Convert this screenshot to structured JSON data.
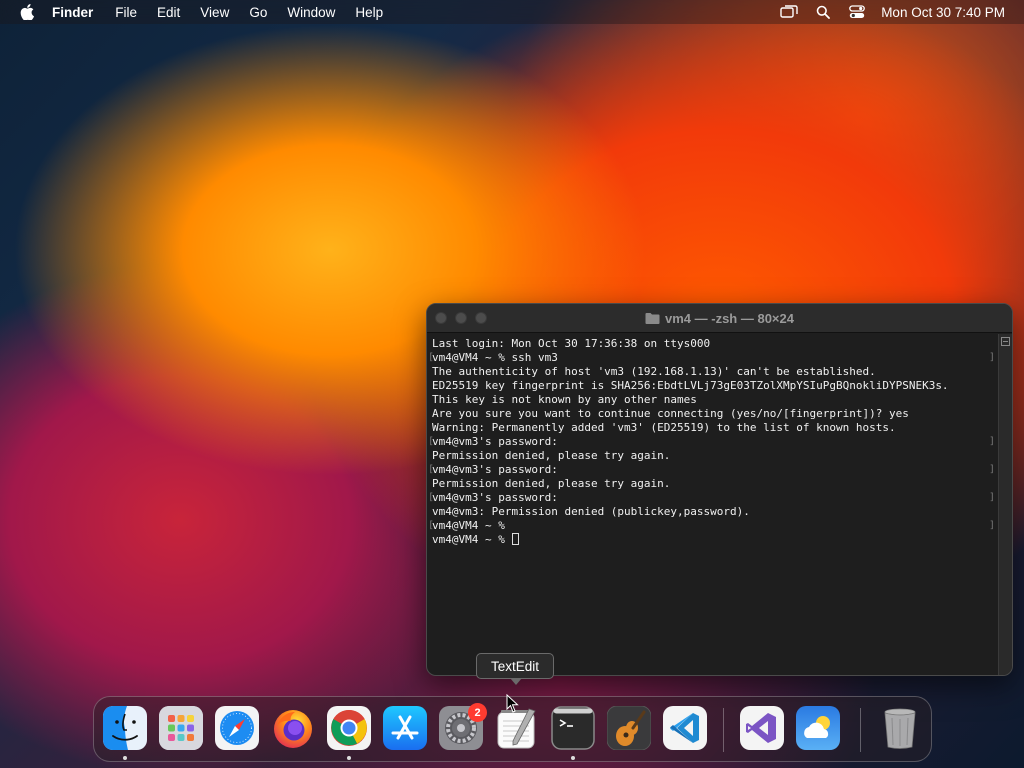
{
  "menubar": {
    "apple_icon": "apple-logo-icon",
    "app_name": "Finder",
    "menus": [
      "File",
      "Edit",
      "View",
      "Go",
      "Window",
      "Help"
    ],
    "status_icons": [
      "screen-mirroring-icon",
      "search-icon",
      "control-center-icon"
    ],
    "clock": "Mon Oct 30  7:40 PM"
  },
  "terminal": {
    "title": "vm4 — -zsh — 80×24",
    "lines": [
      "Last login: Mon Oct 30 17:36:38 on ttys000",
      "vm4@VM4 ~ % ssh vm3",
      "The authenticity of host 'vm3 (192.168.1.13)' can't be established.",
      "ED25519 key fingerprint is SHA256:EbdtLVLj73gE03TZolXMpYSIuPgBQnokliDYPSNEK3s.",
      "This key is not known by any other names",
      "Are you sure you want to continue connecting (yes/no/[fingerprint])? yes",
      "Warning: Permanently added 'vm3' (ED25519) to the list of known hosts.",
      "vm4@vm3's password:",
      "Permission denied, please try again.",
      "vm4@vm3's password:",
      "Permission denied, please try again.",
      "vm4@vm3's password:",
      "vm4@vm3: Permission denied (publickey,password).",
      "vm4@VM4 ~ % ",
      "vm4@VM4 ~ % "
    ]
  },
  "tooltip": {
    "label": "TextEdit"
  },
  "dock": {
    "items": [
      {
        "name": "Finder",
        "icon": "finder-icon",
        "running": true
      },
      {
        "name": "Launchpad",
        "icon": "launchpad-icon",
        "running": false
      },
      {
        "name": "Safari",
        "icon": "safari-icon",
        "running": false
      },
      {
        "name": "Firefox",
        "icon": "firefox-icon",
        "running": false
      },
      {
        "name": "Google Chrome",
        "icon": "chrome-icon",
        "running": true
      },
      {
        "name": "App Store",
        "icon": "app-store-icon",
        "running": false
      },
      {
        "name": "System Settings",
        "icon": "system-settings-icon",
        "running": false,
        "badge": "2"
      },
      {
        "name": "TextEdit",
        "icon": "textedit-icon",
        "running": false
      },
      {
        "name": "Terminal",
        "icon": "terminal-icon",
        "running": true
      },
      {
        "name": "GarageBand",
        "icon": "garageband-icon",
        "running": false
      },
      {
        "name": "Visual Studio Code",
        "icon": "vscode-icon",
        "running": false
      },
      {
        "name": "Visual Studio",
        "icon": "visual-studio-icon",
        "running": false
      },
      {
        "name": "Weather",
        "icon": "weather-icon",
        "running": false
      },
      {
        "name": "Trash",
        "icon": "trash-icon",
        "running": false
      }
    ]
  },
  "colors": {
    "terminal_bg": "#1e1e1e",
    "badge_red": "#ff3b30",
    "vscode_blue": "#1f8ad2",
    "vs_purple": "#7b54c4"
  }
}
